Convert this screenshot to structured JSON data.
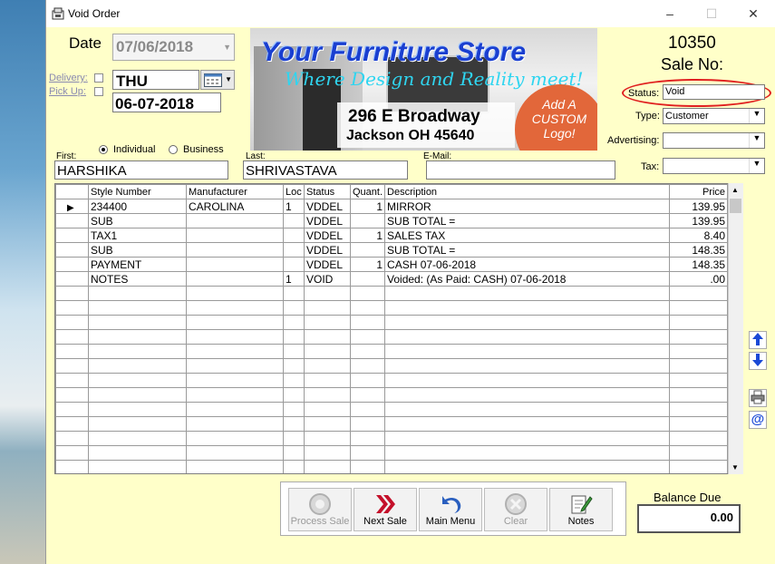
{
  "window": {
    "title": "Void Order"
  },
  "header": {
    "date_label": "Date",
    "date_value": "07/06/2018",
    "delivery_label": "Delivery:",
    "pickup_label": "Pick Up:",
    "day_value": "THU",
    "date2_value": "06-07-2018",
    "sale_number": "10350",
    "sale_no_label": "Sale No:",
    "status_label": "Status:",
    "status_value": "Void",
    "type_label": "Type:",
    "type_value": "Customer",
    "advertising_label": "Advertising:",
    "advertising_value": "",
    "tax_label": "Tax:",
    "tax_value": ""
  },
  "banner": {
    "store_name": "Your Furniture Store",
    "tagline": "Where Design and Reality meet!",
    "street": "296 E Broadway",
    "city": "Jackson OH 45640",
    "custom_logo": [
      "Add A",
      "CUSTOM",
      "Logo!"
    ]
  },
  "customer": {
    "individual_label": "Individual",
    "business_label": "Business",
    "first_label": "First:",
    "first_value": "HARSHIKA",
    "last_label": "Last:",
    "last_value": "SHRIVASTAVA",
    "email_label": "E-Mail:",
    "email_value": ""
  },
  "grid": {
    "columns": [
      "Style Number",
      "Manufacturer",
      "Loc",
      "Status",
      "Quant.",
      "Description",
      "Price"
    ],
    "rows": [
      [
        "234400",
        "CAROLINA",
        "1",
        "VDDEL",
        "1",
        "MIRROR",
        "139.95"
      ],
      [
        "SUB",
        "",
        "",
        "VDDEL",
        "",
        "SUB TOTAL =",
        "139.95"
      ],
      [
        "TAX1",
        "",
        "",
        "VDDEL",
        "1",
        "SALES TAX",
        "8.40"
      ],
      [
        "SUB",
        "",
        "",
        "VDDEL",
        "",
        "SUB TOTAL =",
        "148.35"
      ],
      [
        "PAYMENT",
        "",
        "",
        "VDDEL",
        "1",
        "CASH 07-06-2018",
        "148.35"
      ],
      [
        "NOTES",
        "",
        "1",
        "VOID",
        "",
        "Voided: (As Paid: CASH) 07-06-2018",
        ".00"
      ]
    ]
  },
  "toolbar": {
    "process_sale": "Process Sale",
    "next_sale": "Next Sale",
    "main_menu": "Main Menu",
    "clear": "Clear",
    "notes": "Notes"
  },
  "balance": {
    "label": "Balance Due",
    "value": "0.00"
  },
  "colors": {
    "form_bg": "#ffffc9",
    "highlight_oval": "#e02020",
    "store_name_blue": "#1a3fd0",
    "logo_orange": "#e2673a"
  }
}
